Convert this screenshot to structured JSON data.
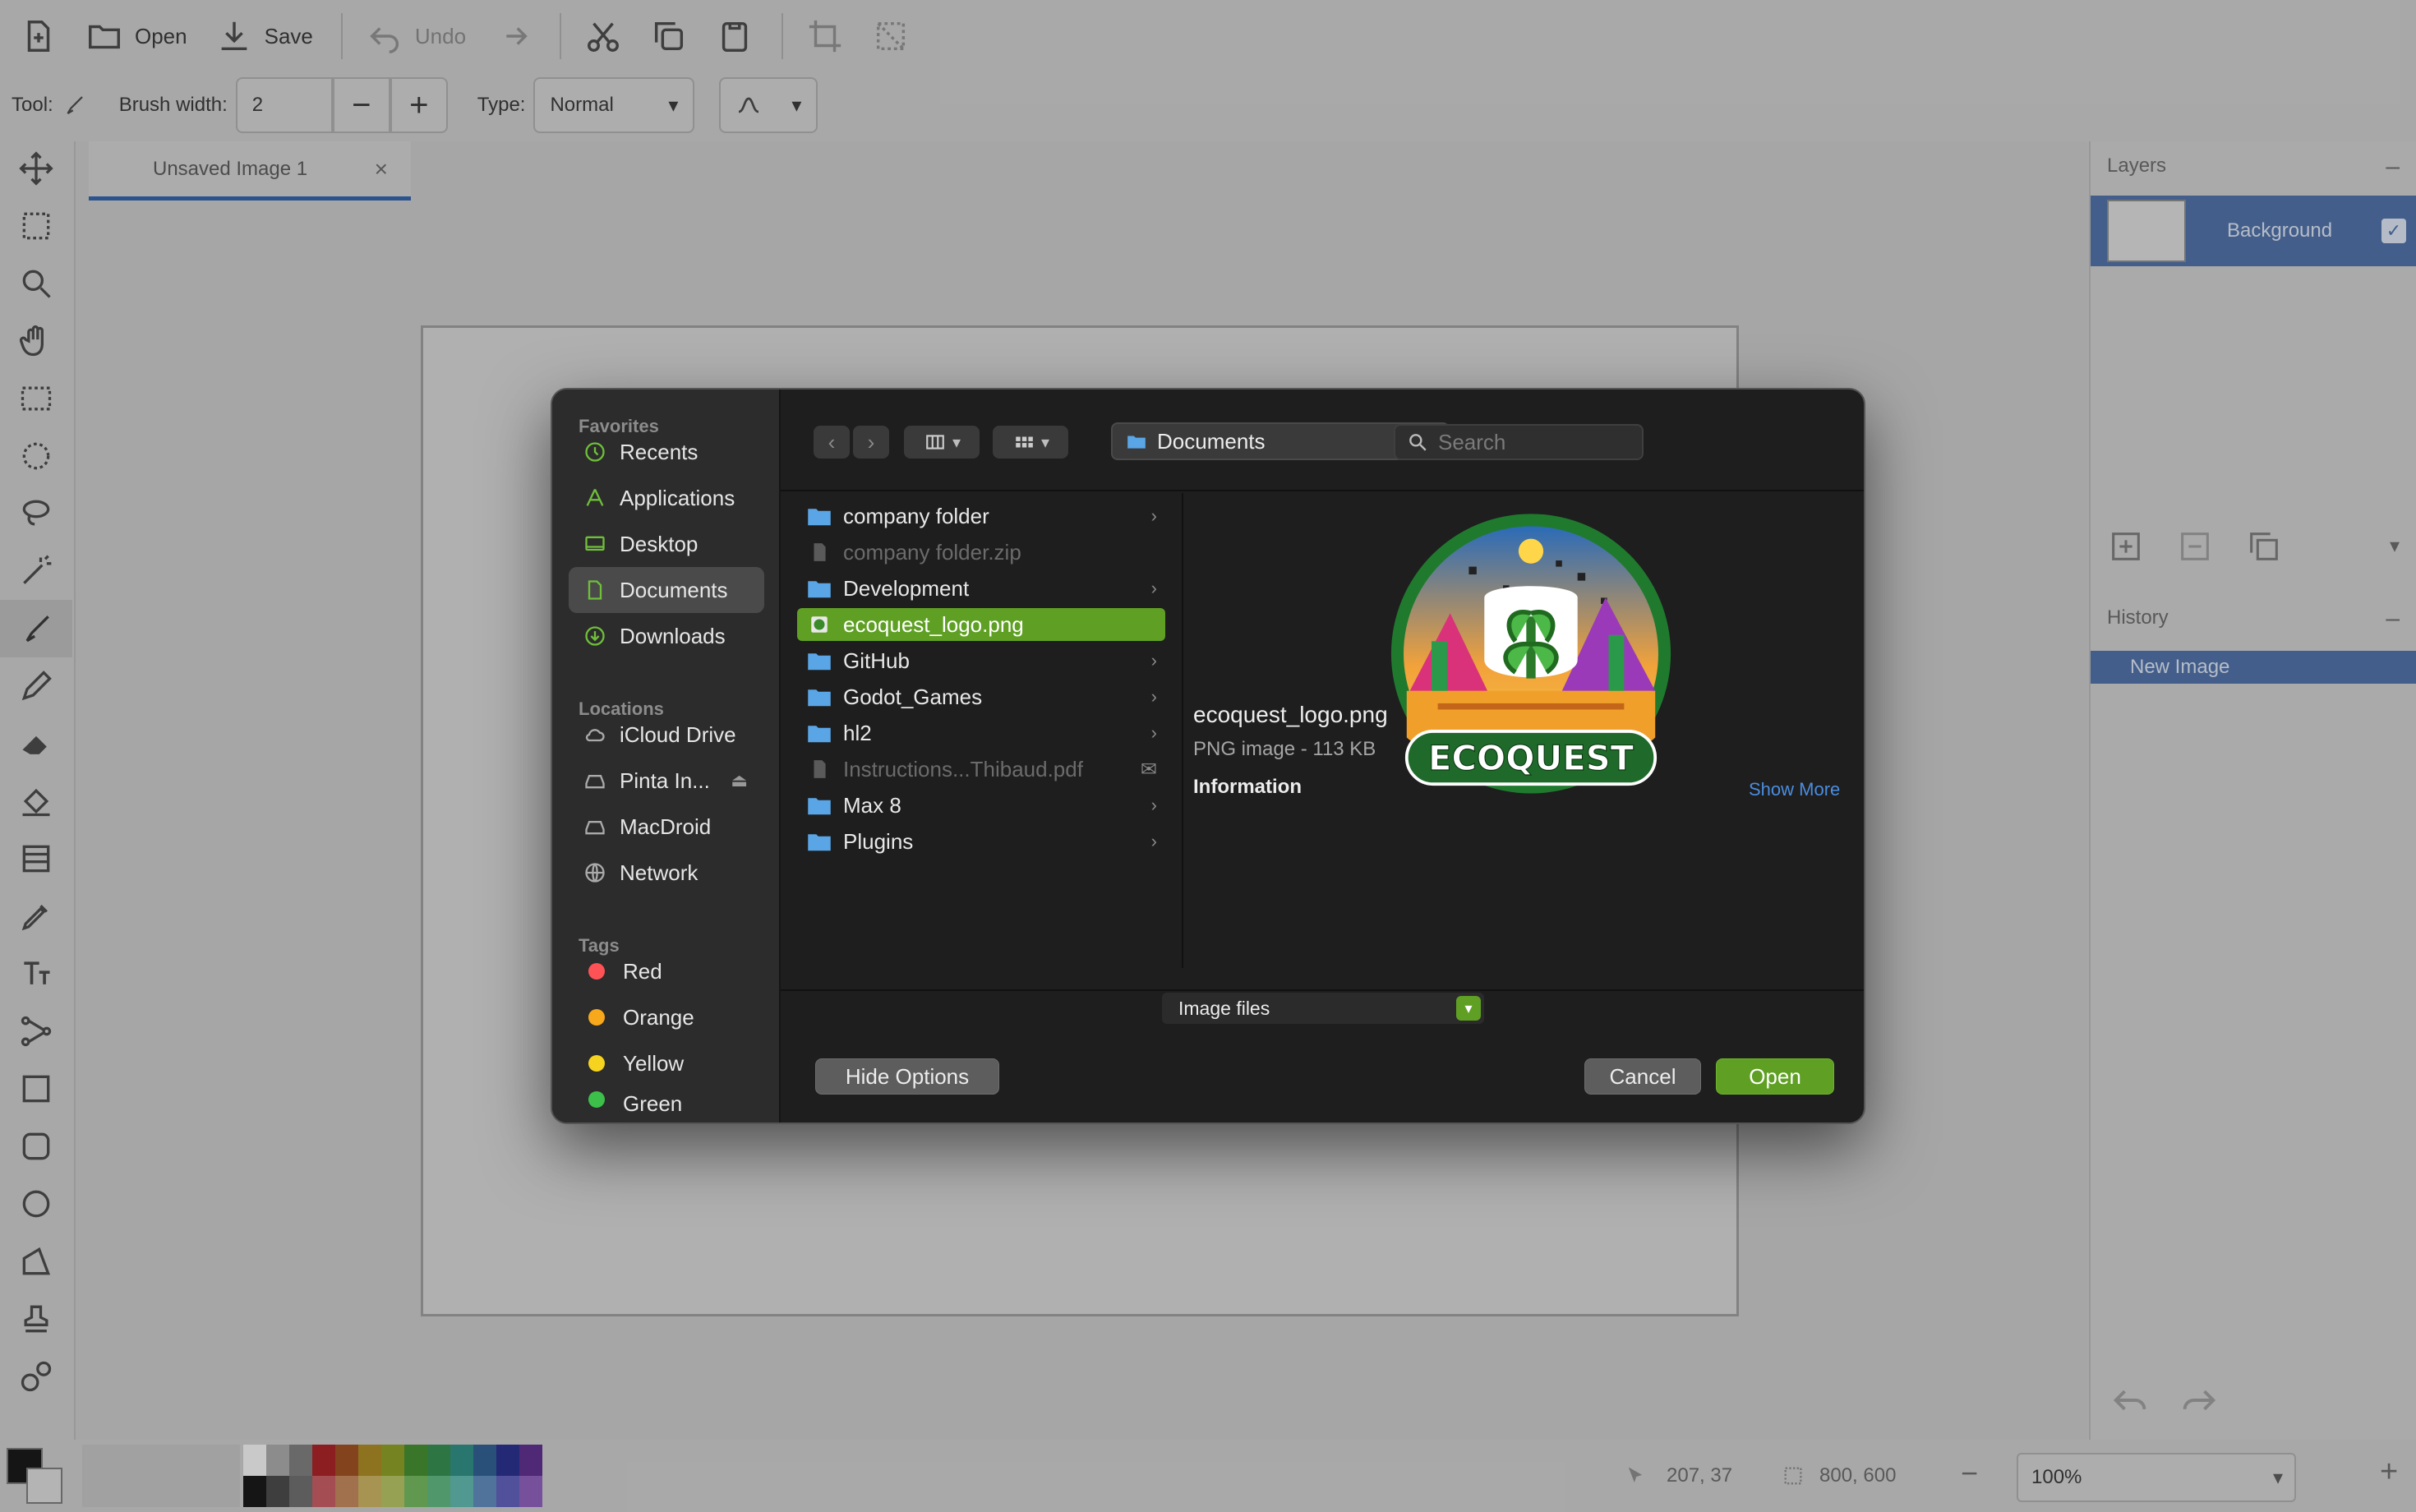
{
  "app": {
    "toolbar": {
      "open_label": "Open",
      "save_label": "Save",
      "undo_label": "Undo"
    },
    "tool_options": {
      "tool_label": "Tool:",
      "brush_width_label": "Brush width:",
      "brush_width_value": "2",
      "type_label": "Type:",
      "type_value": "Normal"
    },
    "document_tab": {
      "title": "Unsaved Image 1"
    },
    "layers_panel": {
      "title": "Layers",
      "layer_name": "Background"
    },
    "history_panel": {
      "title": "History",
      "item": "New Image"
    },
    "status": {
      "cursor_position": "207, 37",
      "selection_size": "800, 600",
      "zoom": "100%"
    },
    "palette_colors_top": [
      "#f2f2f2",
      "#a6a6a6",
      "#7a7a7a",
      "#a51c20",
      "#9a4a1b",
      "#a7861f",
      "#8a9a20",
      "#3f8a2a",
      "#2f8a4a",
      "#2a8a80",
      "#2a5a8e",
      "#232a8a",
      "#5a2a8a"
    ],
    "palette_colors_bottom": [
      "#111111",
      "#444444",
      "#6a6a6a",
      "#c4585e",
      "#c08357",
      "#c7b05d",
      "#b3c05e",
      "#6fb45a",
      "#5ab47c",
      "#5ab4aa",
      "#5a86b8",
      "#5a5ab8",
      "#8a5ab8"
    ]
  },
  "dialog": {
    "sidebar": {
      "favorites_label": "Favorites",
      "favorites": [
        {
          "label": "Recents",
          "icon": "clock-icon"
        },
        {
          "label": "Applications",
          "icon": "applications-icon"
        },
        {
          "label": "Desktop",
          "icon": "desktop-icon"
        },
        {
          "label": "Documents",
          "icon": "document-icon"
        },
        {
          "label": "Downloads",
          "icon": "download-icon"
        }
      ],
      "locations_label": "Locations",
      "locations": [
        {
          "label": "iCloud Drive",
          "icon": "cloud-icon"
        },
        {
          "label": "Pinta In...",
          "icon": "drive-icon"
        },
        {
          "label": "MacDroid",
          "icon": "drive-icon"
        },
        {
          "label": "Network",
          "icon": "globe-icon"
        }
      ],
      "tags_label": "Tags",
      "tags": [
        {
          "label": "Red",
          "color": "#ff5257"
        },
        {
          "label": "Orange",
          "color": "#f7a81b"
        },
        {
          "label": "Yellow",
          "color": "#f5d31f"
        },
        {
          "label": "Green",
          "color": "#3cc04a"
        }
      ]
    },
    "location": "Documents",
    "search_placeholder": "Search",
    "files": [
      {
        "name": "company folder",
        "kind": "folder",
        "has_children": true
      },
      {
        "name": "company folder.zip",
        "kind": "file",
        "disabled": true
      },
      {
        "name": "Development",
        "kind": "folder",
        "has_children": true
      },
      {
        "name": "ecoquest_logo.png",
        "kind": "image",
        "selected": true
      },
      {
        "name": "GitHub",
        "kind": "folder",
        "has_children": true
      },
      {
        "name": "Godot_Games",
        "kind": "folder",
        "has_children": true
      },
      {
        "name": "hl2",
        "kind": "folder",
        "has_children": true
      },
      {
        "name": "Instructions...Thibaud.pdf",
        "kind": "file",
        "disabled": true
      },
      {
        "name": "Max 8",
        "kind": "folder",
        "has_children": true
      },
      {
        "name": "Plugins",
        "kind": "folder",
        "has_children": true
      }
    ],
    "preview": {
      "logo_text": "ECOQUEST",
      "file_name": "ecoquest_logo.png",
      "meta": "PNG image - 113 KB",
      "info_label": "Information",
      "show_more": "Show More"
    },
    "format_filter": "Image files",
    "hide_options_label": "Hide Options",
    "cancel_label": "Cancel",
    "open_label": "Open",
    "accent_color": "#5fa024"
  }
}
